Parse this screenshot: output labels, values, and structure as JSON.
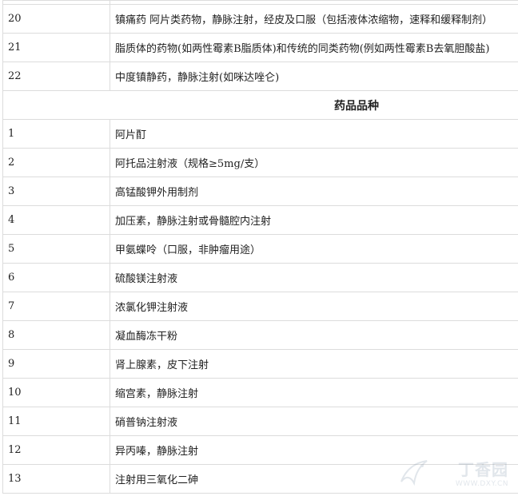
{
  "table": {
    "rows_top": [
      {
        "num": "20",
        "text": "镇痛药 阿片类药物，静脉注射，经皮及口服（包括液体浓缩物，速释和缓释制剂）"
      },
      {
        "num": "21",
        "text": "脂质体的药物(如两性霉素B脂质体)和传统的同类药物(例如两性霉素B去氧胆酸盐)"
      },
      {
        "num": "22",
        "text": "中度镇静药，静脉注射(如咪达唑仑)"
      }
    ],
    "section_header": "药品品种",
    "rows_bottom": [
      {
        "num": "1",
        "text": "阿片酊"
      },
      {
        "num": "2",
        "text": "阿托品注射液（规格≥5mg/支）"
      },
      {
        "num": "3",
        "text": "高锰酸钾外用制剂"
      },
      {
        "num": "4",
        "text": "加压素，静脉注射或骨髓腔内注射"
      },
      {
        "num": "5",
        "text": "甲氨蝶呤（口服，非肿瘤用途）"
      },
      {
        "num": "6",
        "text": "硫酸镁注射液"
      },
      {
        "num": "7",
        "text": "浓氯化钾注射液"
      },
      {
        "num": "8",
        "text": "凝血酶冻干粉"
      },
      {
        "num": "9",
        "text": "肾上腺素，皮下注射"
      },
      {
        "num": "10",
        "text": "缩宫素，静脉注射"
      },
      {
        "num": "11",
        "text": "硝普钠注射液"
      },
      {
        "num": "12",
        "text": "异丙嗪，静脉注射"
      },
      {
        "num": "13",
        "text": "注射用三氧化二砷"
      }
    ]
  },
  "watermark": {
    "title": "丁香园",
    "url": "WWW.DXY.CN"
  }
}
